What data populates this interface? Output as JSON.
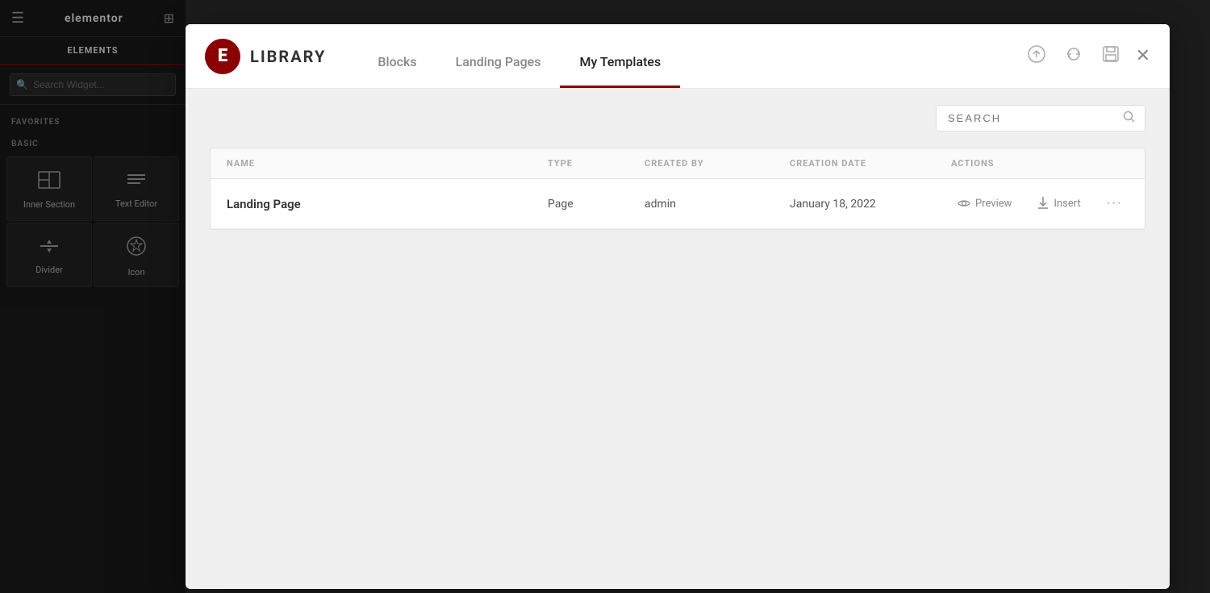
{
  "sidebar": {
    "logo_text": "elementor",
    "tabs": [
      {
        "id": "elements",
        "label": "ELEMENTS",
        "active": true
      }
    ],
    "search_placeholder": "Search Widget...",
    "section_favorites": "FAVORITES",
    "section_basic": "BASIC",
    "widgets": [
      {
        "id": "inner-section",
        "label": "Inner Section",
        "icon": "inner-section-icon"
      },
      {
        "id": "text-editor",
        "label": "Text Editor",
        "icon": "text-editor-icon"
      },
      {
        "id": "divider",
        "label": "Divider",
        "icon": "divider-icon"
      },
      {
        "id": "icon",
        "label": "Icon",
        "icon": "icon-widget-icon"
      }
    ]
  },
  "library": {
    "title": "LIBRARY",
    "tabs": [
      {
        "id": "blocks",
        "label": "Blocks",
        "active": false
      },
      {
        "id": "landing-pages",
        "label": "Landing Pages",
        "active": false
      },
      {
        "id": "my-templates",
        "label": "My Templates",
        "active": true
      }
    ],
    "search_placeholder": "SEARCH",
    "table": {
      "columns": [
        {
          "id": "name",
          "label": "NAME"
        },
        {
          "id": "type",
          "label": "TYPE"
        },
        {
          "id": "created_by",
          "label": "CREATED BY"
        },
        {
          "id": "creation_date",
          "label": "CREATION DATE"
        },
        {
          "id": "actions",
          "label": "ACTIONS"
        }
      ],
      "rows": [
        {
          "name": "Landing Page",
          "type": "Page",
          "created_by": "admin",
          "creation_date": "January 18, 2022",
          "actions": {
            "preview_label": "Preview",
            "insert_label": "Insert"
          }
        }
      ]
    }
  }
}
